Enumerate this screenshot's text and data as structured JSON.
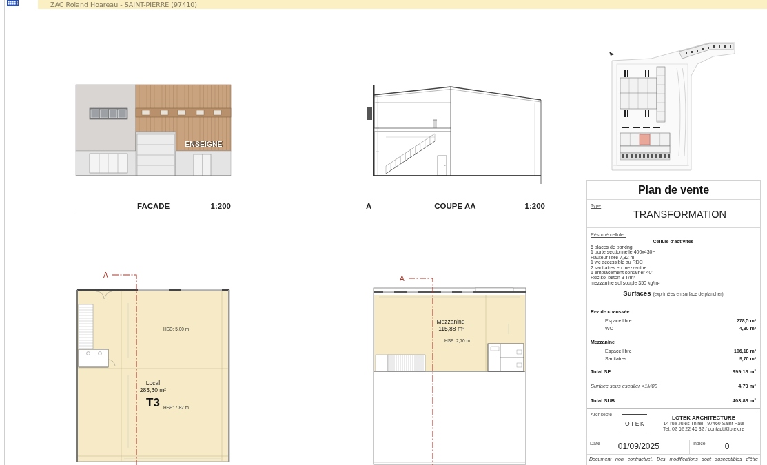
{
  "header": {
    "location": "ZAC Roland Hoareau - SAINT-PIERRE (97410)"
  },
  "drawings": [
    {
      "kind": "facade",
      "sign": "ENSEIGNE",
      "caption": "FACADE",
      "scale": "1:200"
    },
    {
      "kind": "section",
      "section_mark": "A",
      "caption": "COUPE AA",
      "scale": "1:200"
    },
    {
      "kind": "ground_plan",
      "section_mark": "A",
      "room": "Local",
      "area": "283,30 m²",
      "unit": "T3",
      "upper_height": "HSD: 5,00 m",
      "height": "HSP: 7,82 m"
    },
    {
      "kind": "mezzanine_plan",
      "section_mark": "A",
      "room": "Mezzanine",
      "area": "115,88 m²",
      "height": "HSP: 2,70 m"
    }
  ],
  "sales_sheet": {
    "title": "Plan de vente",
    "type_label": "Type",
    "type": "TRANSFORMATION",
    "summary_label": "Résumé cellule :",
    "summary_title": "Cellule d'activités",
    "features": [
      "6 places de parking",
      "1 porte sectionnelle 400x430H",
      "Hauteur libre 7,82 m",
      "1 wc accessible au RDC",
      "2 sanitaires en mezzanine",
      "1 emplacement container 40\"",
      "Rdc sol béton 3 T/m²",
      "mezzanine sol souple 350 kg/m²"
    ],
    "surfaces_title": "Surfaces",
    "surfaces_note": "(exprimées en surface de plancher)",
    "levels": [
      {
        "name": "Rez de chaussée",
        "rows": [
          {
            "label": "Espace libre",
            "value": "278,5 m²"
          },
          {
            "label": "WC",
            "value": "4,80 m²"
          }
        ]
      },
      {
        "name": "Mezzanine",
        "rows": [
          {
            "label": "Espace libre",
            "value": "106,18 m²"
          },
          {
            "label": "Sanitaires",
            "value": "9,70 m²"
          }
        ]
      }
    ],
    "totals": [
      {
        "kind": "total",
        "label": "Total SP",
        "value": "399,18 m²"
      },
      {
        "kind": "note",
        "label": "Surface sous escalier <1M80",
        "value": "4,70 m²"
      },
      {
        "kind": "total",
        "label": "Total SUB",
        "value": "403,88 m²"
      }
    ],
    "architect": {
      "label": "Architecte",
      "logo": "OTEK",
      "name": "LOTEK ARCHITECTURE",
      "address": "14 rue Jules Thirel - 97460 Saint Paul",
      "contact": "Tel: 02 62 22 46 32 / contact@lotek.re"
    },
    "date_label": "Date",
    "date": "01/09/2025",
    "index_label": "Indice",
    "index": "0",
    "disclaimer": "Document non contractuel. Des modifications sont susceptibles d'être"
  }
}
